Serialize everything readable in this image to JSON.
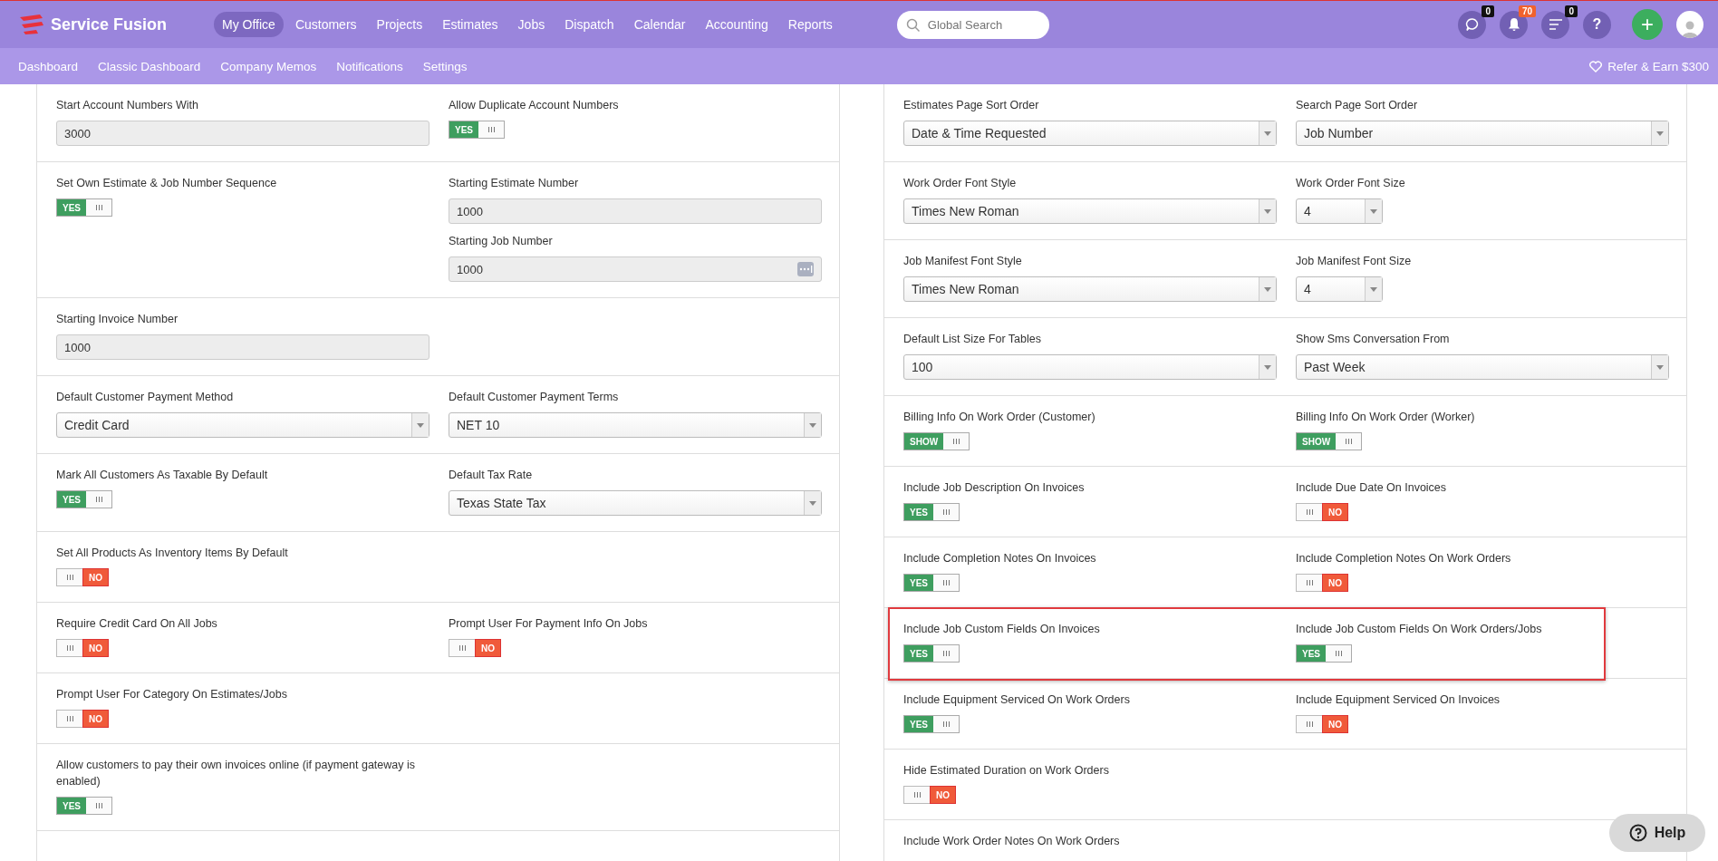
{
  "header": {
    "logo": "Service Fusion",
    "nav": [
      {
        "label": "My Office",
        "selected": true
      },
      {
        "label": "Customers",
        "selected": false
      },
      {
        "label": "Projects",
        "selected": false
      },
      {
        "label": "Estimates",
        "selected": false
      },
      {
        "label": "Jobs",
        "selected": false
      },
      {
        "label": "Dispatch",
        "selected": false
      },
      {
        "label": "Calendar",
        "selected": false
      },
      {
        "label": "Accounting",
        "selected": false
      },
      {
        "label": "Reports",
        "selected": false
      }
    ],
    "search": {
      "placeholder": "Global Search"
    },
    "icons": [
      {
        "kind": "chat",
        "badge": "0"
      },
      {
        "kind": "bell",
        "badge": "70"
      },
      {
        "kind": "list",
        "badge": "0"
      },
      {
        "kind": "help",
        "text": "?"
      }
    ],
    "add_button": "+"
  },
  "subnav": {
    "items": [
      "Dashboard",
      "Classic Dashboard",
      "Company Memos",
      "Notifications",
      "Settings"
    ],
    "refer": "Refer & Earn $300"
  },
  "left_panel": {
    "rows": [
      {
        "columns": [
          [
            {
              "label": "Start Account Numbers With",
              "kind": "input",
              "value": "3000",
              "disabled": true
            }
          ],
          [
            {
              "label": "Allow Duplicate Account Numbers",
              "kind": "toggle",
              "on": true,
              "text": "YES"
            }
          ]
        ]
      },
      {
        "columns": [
          [
            {
              "label": "Set Own Estimate & Job Number Sequence",
              "kind": "toggle",
              "on": true,
              "text": "YES"
            }
          ],
          [
            {
              "label": "Starting Estimate Number",
              "kind": "input",
              "value": "1000",
              "disabled": true
            },
            {
              "label": "Starting Job Number",
              "kind": "input-addon",
              "value": "1000",
              "disabled": true
            }
          ]
        ]
      },
      {
        "columns": [
          [
            {
              "label": "Starting Invoice Number",
              "kind": "input",
              "value": "1000",
              "disabled": true
            }
          ]
        ]
      },
      {
        "columns": [
          [
            {
              "label": "Default Customer Payment Method",
              "kind": "select",
              "value": "Credit Card"
            }
          ],
          [
            {
              "label": "Default Customer Payment Terms",
              "kind": "select",
              "value": "NET 10"
            }
          ]
        ]
      },
      {
        "columns": [
          [
            {
              "label": "Mark All Customers As Taxable By Default",
              "kind": "toggle",
              "on": true,
              "text": "YES"
            }
          ],
          [
            {
              "label": "Default Tax Rate",
              "kind": "select",
              "value": "Texas State Tax"
            }
          ]
        ]
      },
      {
        "columns": [
          [
            {
              "label": "Set All Products As Inventory Items By Default",
              "kind": "toggle",
              "on": false,
              "text": "NO"
            }
          ]
        ]
      },
      {
        "columns": [
          [
            {
              "label": "Require Credit Card On All Jobs",
              "kind": "toggle",
              "on": false,
              "text": "NO"
            }
          ],
          [
            {
              "label": "Prompt User For Payment Info On Jobs",
              "kind": "toggle",
              "on": false,
              "text": "NO"
            }
          ]
        ]
      },
      {
        "columns": [
          [
            {
              "label": "Prompt User For Category On Estimates/Jobs",
              "kind": "toggle",
              "on": false,
              "text": "NO"
            }
          ]
        ]
      },
      {
        "columns": [
          [
            {
              "label": "Allow customers to pay their own invoices online (if payment gateway is enabled)",
              "kind": "toggle",
              "on": true,
              "text": "YES"
            }
          ]
        ]
      }
    ]
  },
  "right_panel": {
    "rows": [
      {
        "columns": [
          [
            {
              "label": "Estimates Page Sort Order",
              "kind": "select",
              "value": "Date & Time Requested"
            }
          ],
          [
            {
              "label": "Search Page Sort Order",
              "kind": "select",
              "value": "Job Number"
            }
          ]
        ]
      },
      {
        "columns": [
          [
            {
              "label": "Work Order Font Style",
              "kind": "select",
              "value": "Times New Roman"
            }
          ],
          [
            {
              "label": "Work Order Font Size",
              "kind": "small-select",
              "value": "4"
            }
          ]
        ]
      },
      {
        "columns": [
          [
            {
              "label": "Job Manifest Font Style",
              "kind": "select",
              "value": "Times New Roman"
            }
          ],
          [
            {
              "label": "Job Manifest Font Size",
              "kind": "small-select",
              "value": "4"
            }
          ]
        ]
      },
      {
        "columns": [
          [
            {
              "label": "Default List Size For Tables",
              "kind": "select",
              "value": "100"
            }
          ],
          [
            {
              "label": "Show Sms Conversation From",
              "kind": "select",
              "value": "Past Week"
            }
          ]
        ]
      },
      {
        "columns": [
          [
            {
              "label": "Billing Info On Work Order (Customer)",
              "kind": "toggle",
              "on": true,
              "text": "SHOW"
            }
          ],
          [
            {
              "label": "Billing Info On Work Order (Worker)",
              "kind": "toggle",
              "on": true,
              "text": "SHOW"
            }
          ]
        ]
      },
      {
        "columns": [
          [
            {
              "label": "Include Job Description On Invoices",
              "kind": "toggle",
              "on": true,
              "text": "YES"
            }
          ],
          [
            {
              "label": "Include Due Date On Invoices",
              "kind": "toggle",
              "on": false,
              "text": "NO"
            }
          ]
        ]
      },
      {
        "columns": [
          [
            {
              "label": "Include Completion Notes On Invoices",
              "kind": "toggle",
              "on": true,
              "text": "YES"
            }
          ],
          [
            {
              "label": "Include Completion Notes On Work Orders",
              "kind": "toggle",
              "on": false,
              "text": "NO"
            }
          ]
        ]
      },
      {
        "highlighted": true,
        "columns": [
          [
            {
              "label": "Include Job Custom Fields On Invoices",
              "kind": "toggle",
              "on": true,
              "text": "YES"
            }
          ],
          [
            {
              "label": "Include Job Custom Fields On Work Orders/Jobs",
              "kind": "toggle",
              "on": true,
              "text": "YES"
            }
          ]
        ]
      },
      {
        "columns": [
          [
            {
              "label": "Include Equipment Serviced On Work Orders",
              "kind": "toggle",
              "on": true,
              "text": "YES"
            }
          ],
          [
            {
              "label": "Include Equipment Serviced On Invoices",
              "kind": "toggle",
              "on": false,
              "text": "NO"
            }
          ]
        ]
      },
      {
        "columns": [
          [
            {
              "label": "Hide Estimated Duration on Work Orders",
              "kind": "toggle",
              "on": false,
              "text": "NO"
            }
          ]
        ]
      },
      {
        "columns": [
          [
            {
              "label": "Include Work Order Notes On Work Orders",
              "kind": "label"
            }
          ]
        ]
      }
    ]
  },
  "help_button": "Help"
}
